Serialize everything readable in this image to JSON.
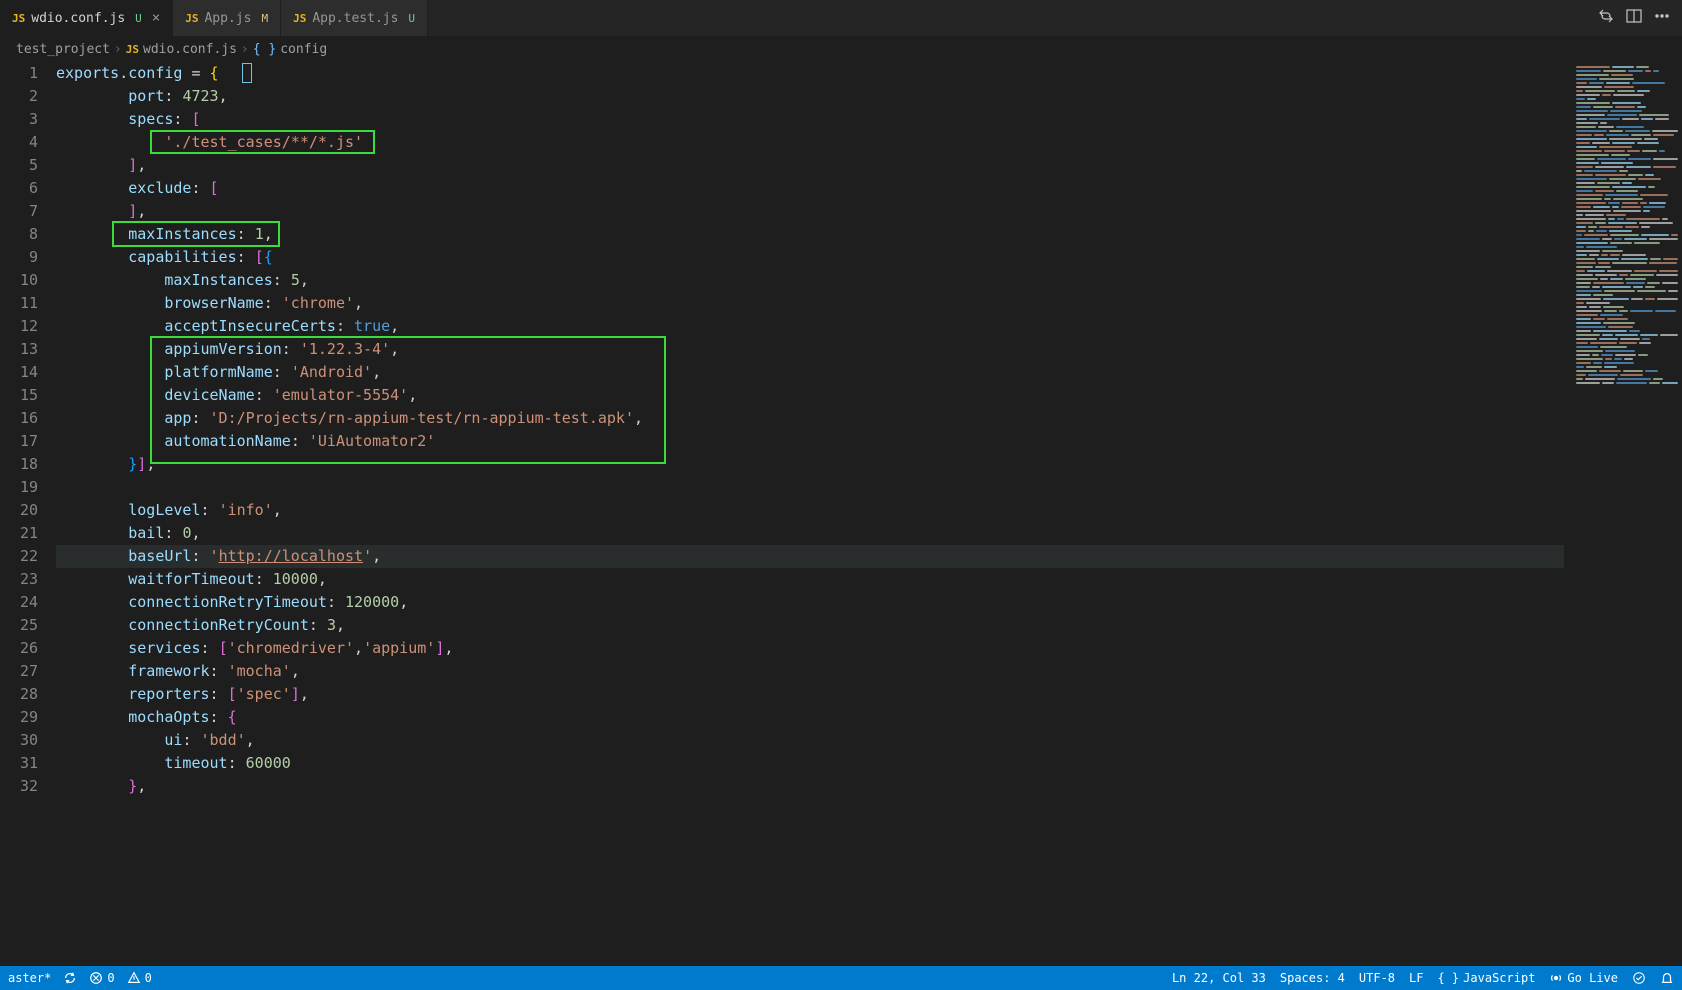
{
  "tabs": [
    {
      "icon": "JS",
      "name": "wdio.conf.js",
      "status": "U",
      "active": true
    },
    {
      "icon": "JS",
      "name": "App.js",
      "status": "M",
      "active": false
    },
    {
      "icon": "JS",
      "name": "App.test.js",
      "status": "U",
      "active": false
    }
  ],
  "breadcrumb": {
    "project": "test_project",
    "file": "wdio.conf.js",
    "symbol": "config"
  },
  "code": {
    "l1": {
      "var": "exports",
      "dot": ".",
      "prop": "config",
      "eq": " = ",
      "brace": "{"
    },
    "l2": {
      "indent": "        ",
      "key": "port",
      "colon": ": ",
      "val": "4723",
      "comma": ","
    },
    "l3": {
      "indent": "        ",
      "key": "specs",
      "colon": ": ",
      "br": "["
    },
    "l4": {
      "indent": "            ",
      "str": "'./test_cases/**/*.js'"
    },
    "l5": {
      "indent": "        ",
      "br": "]",
      "comma": ","
    },
    "l6": {
      "indent": "        ",
      "key": "exclude",
      "colon": ": ",
      "br": "["
    },
    "l7": {
      "indent": "        ",
      "br": "]",
      "comma": ","
    },
    "l8": {
      "indent": "        ",
      "key": "maxInstances",
      "colon": ": ",
      "val": "1",
      "comma": ","
    },
    "l9": {
      "indent": "        ",
      "key": "capabilities",
      "colon": ": ",
      "br": "[{"
    },
    "l10": {
      "indent": "            ",
      "key": "maxInstances",
      "colon": ": ",
      "val": "5",
      "comma": ","
    },
    "l11": {
      "indent": "            ",
      "key": "browserName",
      "colon": ": ",
      "str": "'chrome'",
      "comma": ","
    },
    "l12": {
      "indent": "            ",
      "key": "acceptInsecureCerts",
      "colon": ": ",
      "bool": "true",
      "comma": ","
    },
    "l13": {
      "indent": "            ",
      "key": "appiumVersion",
      "colon": ": ",
      "str": "'1.22.3-4'",
      "comma": ","
    },
    "l14": {
      "indent": "            ",
      "key": "platformName",
      "colon": ": ",
      "str": "'Android'",
      "comma": ","
    },
    "l15": {
      "indent": "            ",
      "key": "deviceName",
      "colon": ": ",
      "str": "'emulator-5554'",
      "comma": ","
    },
    "l16": {
      "indent": "            ",
      "key": "app",
      "colon": ": ",
      "str": "'D:/Projects/rn-appium-test/rn-appium-test.apk'",
      "comma": ","
    },
    "l17": {
      "indent": "            ",
      "key": "automationName",
      "colon": ": ",
      "str": "'UiAutomator2'"
    },
    "l18": {
      "indent": "        ",
      "br": "}]",
      "comma": ","
    },
    "l19": {
      "indent": ""
    },
    "l20": {
      "indent": "        ",
      "key": "logLevel",
      "colon": ": ",
      "str": "'info'",
      "comma": ","
    },
    "l21": {
      "indent": "        ",
      "key": "bail",
      "colon": ": ",
      "val": "0",
      "comma": ","
    },
    "l22": {
      "indent": "        ",
      "key": "baseUrl",
      "colon": ": ",
      "q": "'",
      "url": "http://localhost",
      "qe": "'",
      "comma": ","
    },
    "l23": {
      "indent": "        ",
      "key": "waitforTimeout",
      "colon": ": ",
      "val": "10000",
      "comma": ","
    },
    "l24": {
      "indent": "        ",
      "key": "connectionRetryTimeout",
      "colon": ": ",
      "val": "120000",
      "comma": ","
    },
    "l25": {
      "indent": "        ",
      "key": "connectionRetryCount",
      "colon": ": ",
      "val": "3",
      "comma": ","
    },
    "l26": {
      "indent": "        ",
      "key": "services",
      "colon": ": ",
      "br1": "[",
      "str1": "'chromedriver'",
      "c": ",",
      "str2": "'appium'",
      "br2": "]",
      "comma": ","
    },
    "l27": {
      "indent": "        ",
      "key": "framework",
      "colon": ": ",
      "str": "'mocha'",
      "comma": ","
    },
    "l28": {
      "indent": "        ",
      "key": "reporters",
      "colon": ": ",
      "br1": "[",
      "str": "'spec'",
      "br2": "]",
      "comma": ","
    },
    "l29": {
      "indent": "        ",
      "key": "mochaOpts",
      "colon": ": ",
      "br": "{"
    },
    "l30": {
      "indent": "            ",
      "key": "ui",
      "colon": ": ",
      "str": "'bdd'",
      "comma": ","
    },
    "l31": {
      "indent": "            ",
      "key": "timeout",
      "colon": ": ",
      "val": "60000"
    },
    "l32": {
      "indent": "        ",
      "br": "}",
      "comma": ","
    }
  },
  "statusbar": {
    "branch": "aster*",
    "errors": "0",
    "warnings": "0",
    "position": "Ln 22, Col 33",
    "spaces": "Spaces: 4",
    "encoding": "UTF-8",
    "eol": "LF",
    "lang": "JavaScript",
    "golive": "Go Live"
  }
}
